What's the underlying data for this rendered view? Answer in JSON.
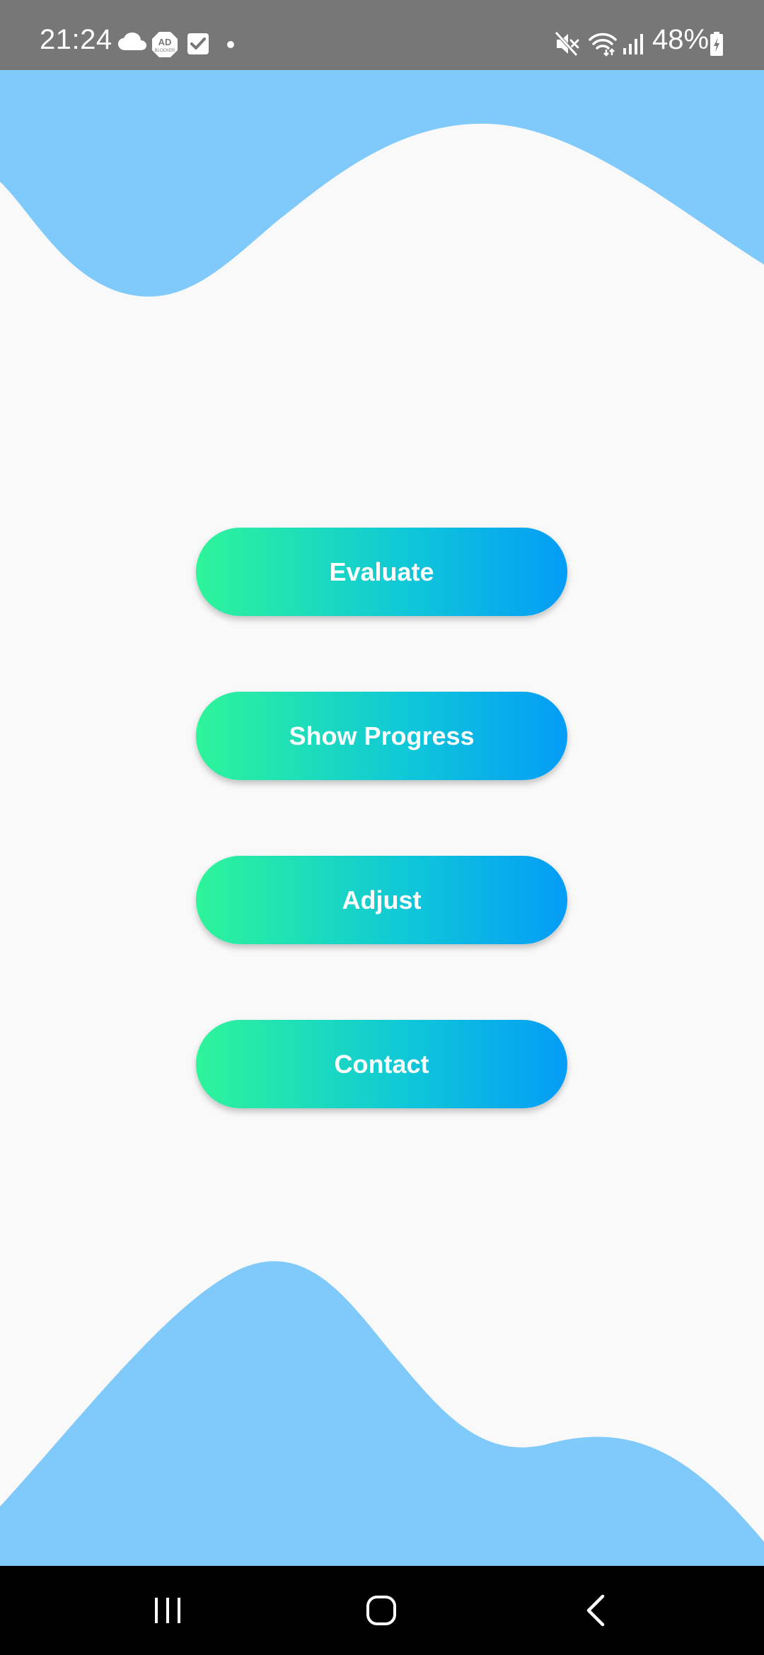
{
  "status_bar": {
    "time": "21:24",
    "battery_percent": "48%",
    "left_icons": [
      "cloud-icon",
      "ad-blocker-icon",
      "checkbox-icon",
      "dot-icon"
    ],
    "right_icons": [
      "mute-icon",
      "wifi-icon",
      "signal-icon",
      "battery-charging-icon"
    ],
    "ad_blocker_text": "AD",
    "ad_blocker_subtext": "BLOCKER",
    "background_color": "#777777"
  },
  "decor": {
    "wave_color": "#80cafb",
    "page_background": "#f9f9f9"
  },
  "menu": {
    "buttons": [
      {
        "label": "Evaluate"
      },
      {
        "label": "Show Progress"
      },
      {
        "label": "Adjust"
      },
      {
        "label": "Contact"
      }
    ],
    "gradient_start": "#2ef49a",
    "gradient_end": "#039cf7"
  },
  "nav_bar": {
    "buttons": [
      "recents-icon",
      "home-icon",
      "back-icon"
    ]
  }
}
